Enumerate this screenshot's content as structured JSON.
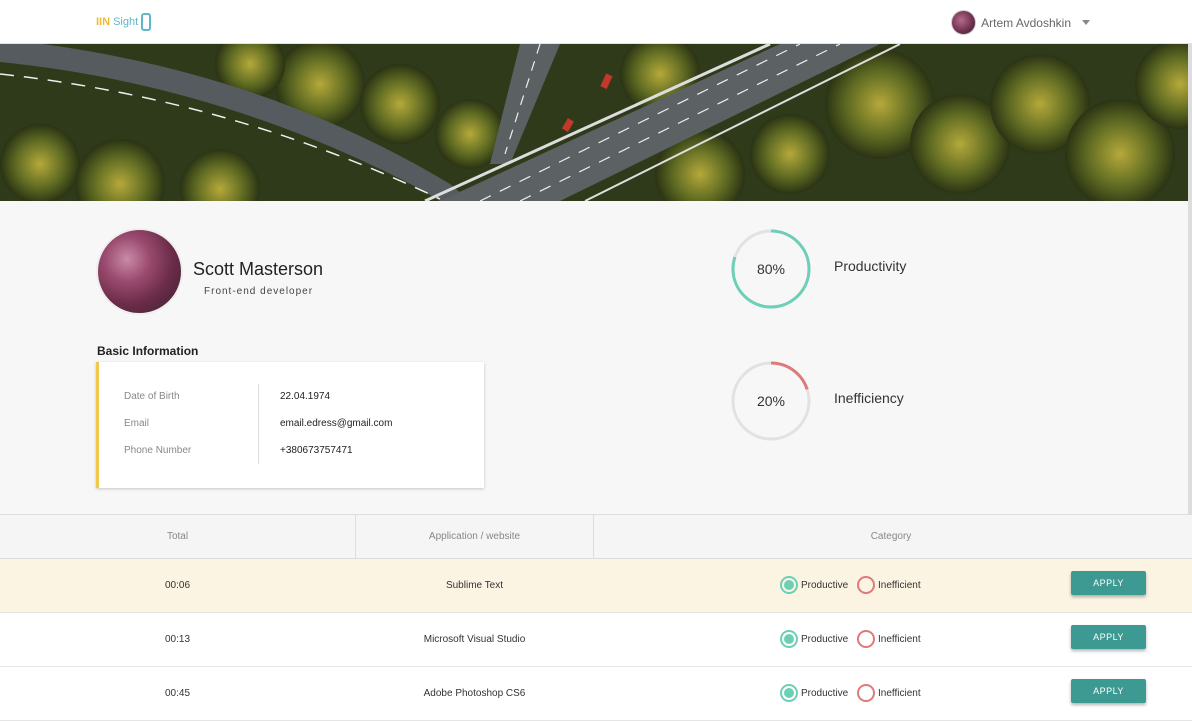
{
  "header": {
    "logo_text_a": "IIN",
    "logo_text_b": "Sight",
    "user_name": "Artem Avdoshkin"
  },
  "profile": {
    "name": "Scott Masterson",
    "role": "Front-end developer"
  },
  "basic_info": {
    "heading": "Basic Information",
    "rows": [
      {
        "label": "Date of Birth",
        "value": "22.04.1974"
      },
      {
        "label": "Email",
        "value": "email.edress@gmail.com"
      },
      {
        "label": "Phone Number",
        "value": "+380673757471"
      }
    ]
  },
  "stats": [
    {
      "value": "80%",
      "label": "Productivity",
      "fraction": 0.8,
      "color": "#6ccfb6"
    },
    {
      "value": "20%",
      "label": "Inefficiency",
      "fraction": 0.2,
      "color": "#e07a7a"
    }
  ],
  "table": {
    "headers": [
      "Total",
      "Application / website",
      "Category"
    ],
    "productive_label": "Productive",
    "inefficient_label": "Inefficient",
    "apply_label": "APPLY",
    "rows": [
      {
        "total": "00:06",
        "app": "Sublime Text"
      },
      {
        "total": "00:13",
        "app": "Microsoft Visual Studio"
      },
      {
        "total": "00:45",
        "app": "Adobe Photoshop CS6"
      }
    ]
  },
  "colors": {
    "accent_teal": "#3d9a92",
    "productive": "#6ccfb6",
    "inefficient": "#e07a7a",
    "card_border": "#f2c94c",
    "highlight_row": "#fcf4e3"
  }
}
